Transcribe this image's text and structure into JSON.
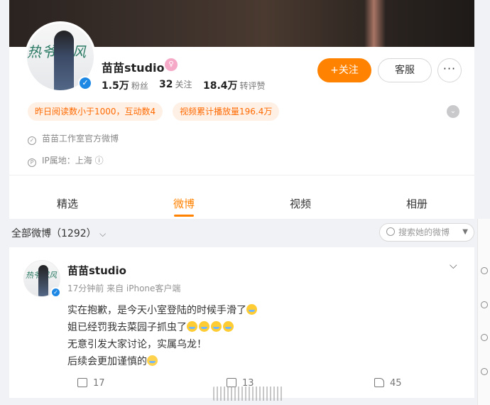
{
  "profile": {
    "name": "苗苗studio",
    "avatar_text": "热爷成风",
    "stats": [
      {
        "value": "1.5万",
        "label": "粉丝"
      },
      {
        "value": "32",
        "label": "关注"
      },
      {
        "value": "18.4万",
        "label": "转评赞"
      }
    ],
    "follow_label": "+关注",
    "cs_label": "客服",
    "more_label": "···",
    "tags": [
      "昨日阅读数小于1000，互动数4",
      "视频累计播放量196.4万"
    ],
    "verification": "苗苗工作室官方微博",
    "ip_location": "IP属地：上海 ⓘ"
  },
  "tabs": [
    "精选",
    "微博",
    "视频",
    "相册"
  ],
  "active_tab": "微博",
  "filter": {
    "label": "全部微博（1292）",
    "chevron": "⌵",
    "search_placeholder": "搜索她的微博",
    "search_caret": "▼"
  },
  "post": {
    "author": "苗苗studio",
    "meta": "17分钟前  来自 iPhone客户端",
    "chevron": "⌵",
    "lines": [
      "实在抱歉，是今天小室登陆的时候手滑了",
      "姐已经罚我去菜园子抓虫了",
      "无意引发大家讨论，实属乌龙！",
      "后续会更加谨慎的"
    ],
    "actions": {
      "repost": "17",
      "comment": "13",
      "like": "45"
    }
  },
  "colors": {
    "accent": "#ff8200",
    "verify": "#1e88e5",
    "tag_bg": "#fff0e6",
    "tag_text": "#ff6a00"
  },
  "icons": [
    "search-icon",
    "verified-icon",
    "shield-icon",
    "location-icon",
    "repost-icon",
    "comment-icon",
    "like-icon",
    "chevron-down-icon",
    "more-icon",
    "crying-emoji",
    "sad-emoji"
  ]
}
